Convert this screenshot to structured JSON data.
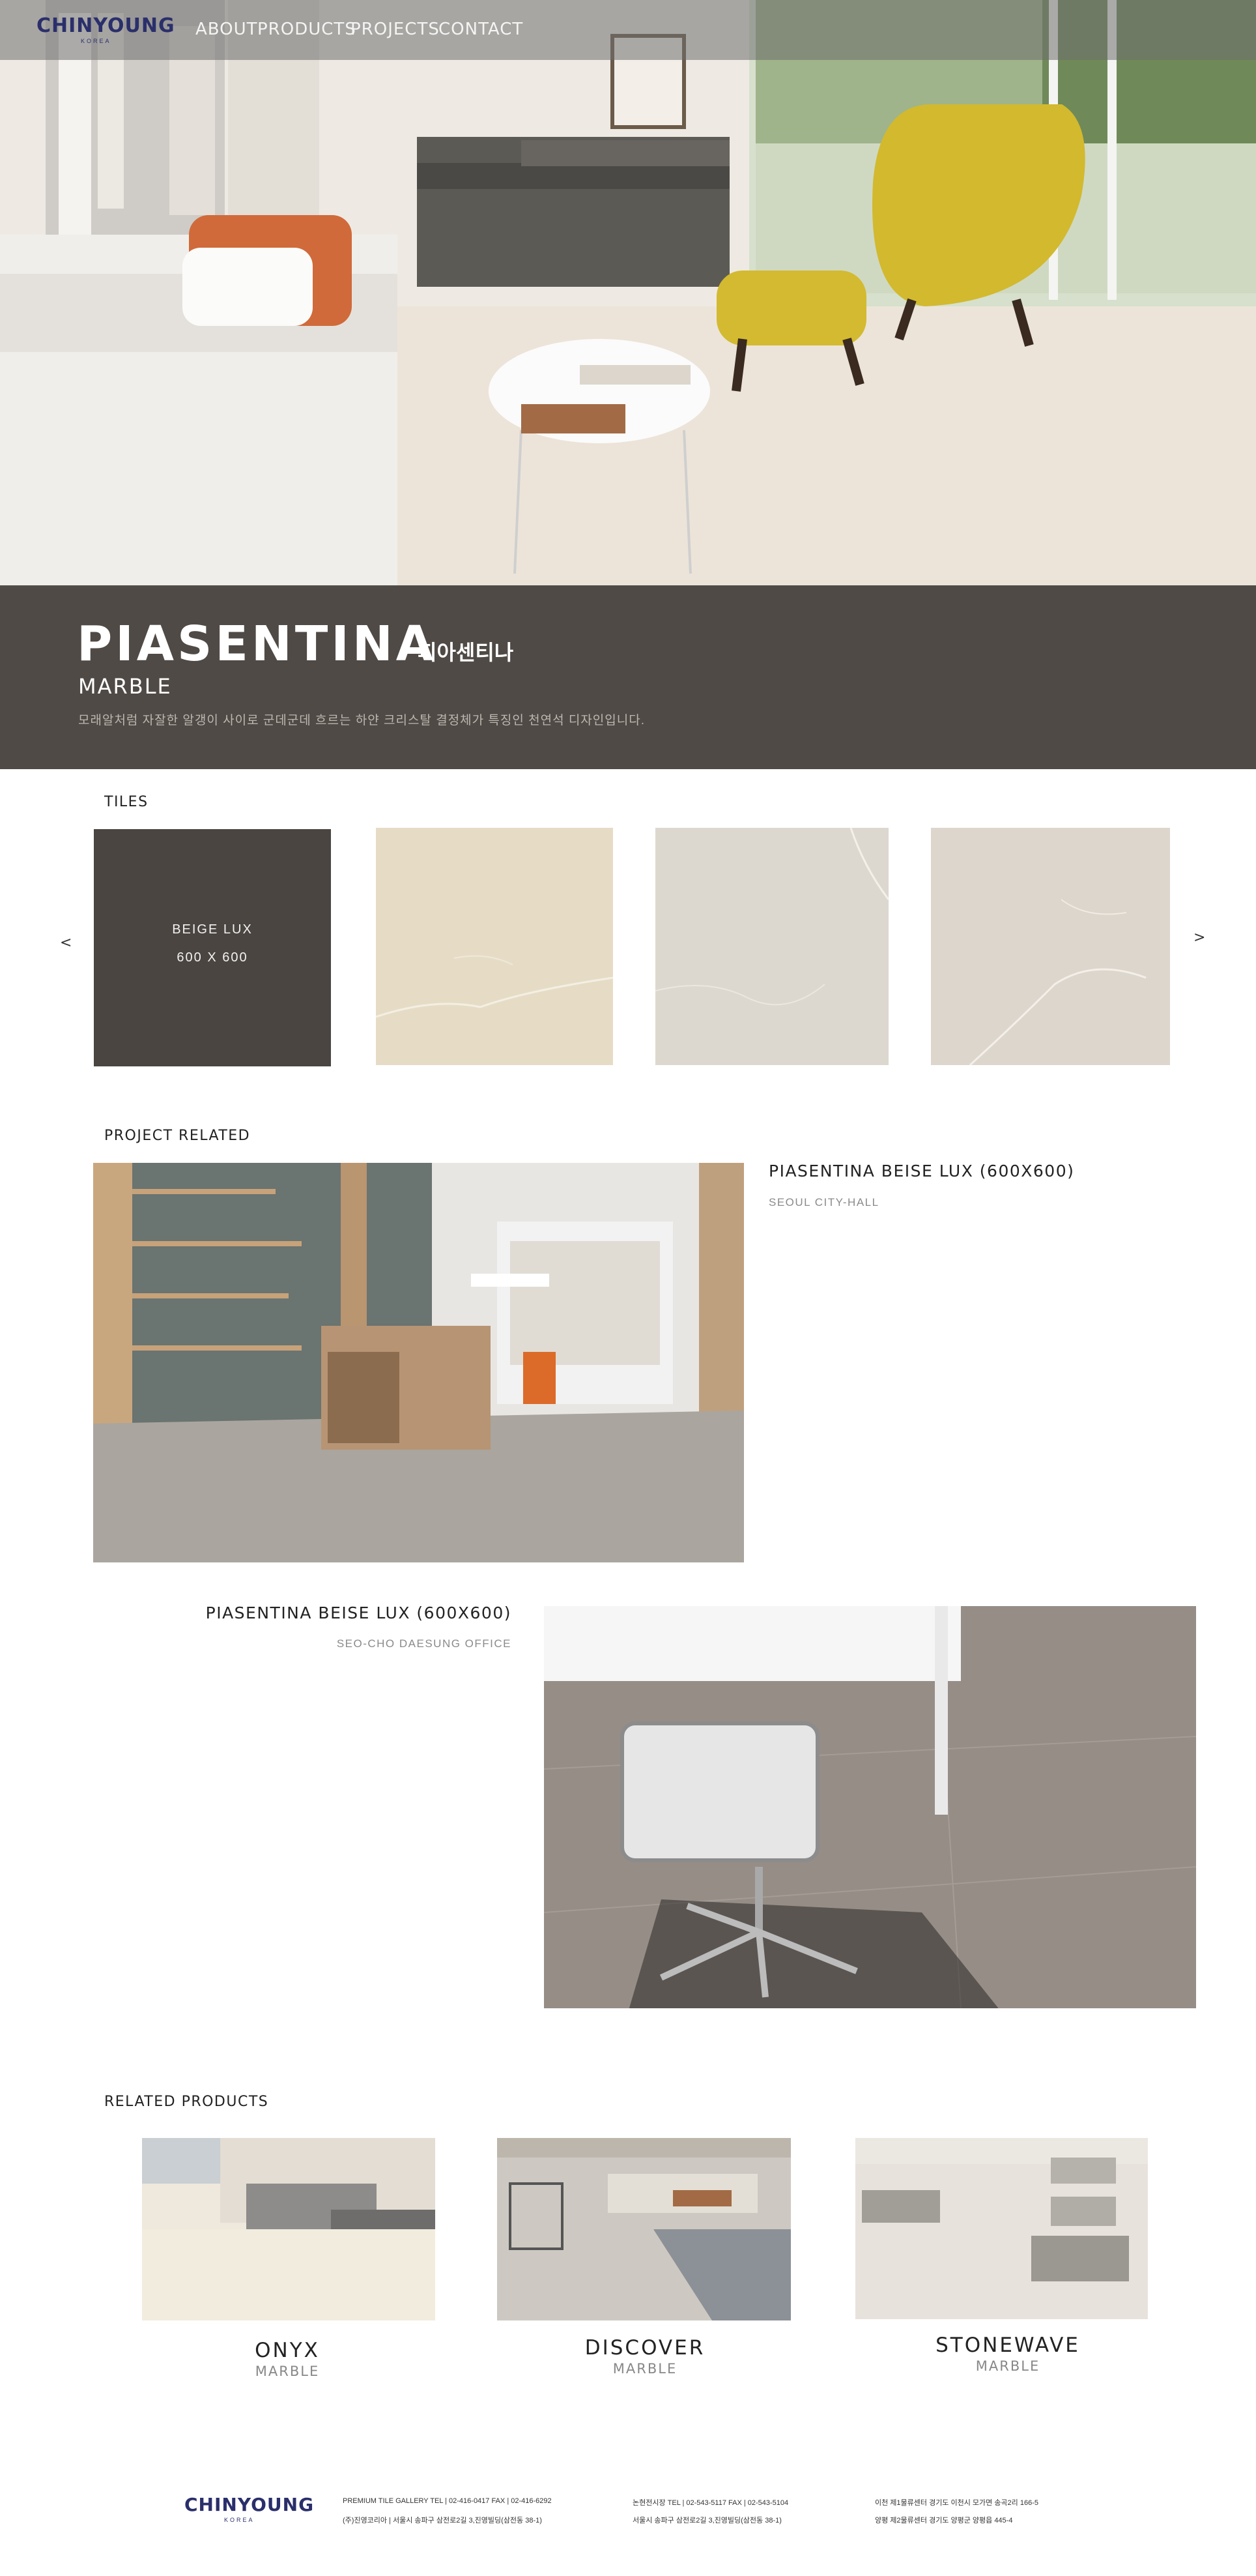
{
  "brand": {
    "logo": "CHINYOUNG",
    "logo_sub": "KOREA"
  },
  "nav": {
    "items": [
      "ABOUT",
      "PRODUCTS",
      "PROJECTS",
      "CONTACT"
    ]
  },
  "hero": {
    "title": "PIASENTINA",
    "title_ko": "피아센티나",
    "category": "MARBLE",
    "description": "모래알처럼 자잘한 알갱이 사이로 군데군데 흐르는 하얀 크리스탈 결정체가 특징인 천연석 디자인입니다."
  },
  "tiles": {
    "heading": "TILES",
    "prev": "<",
    "next": ">",
    "items": [
      {
        "name": "BEIGE LUX",
        "size": "600 X 600",
        "color": "#4a4541"
      },
      {
        "color": "#e6dcc6"
      },
      {
        "color": "#ddd8cf"
      },
      {
        "color": "#ddd6cc"
      }
    ]
  },
  "projects": {
    "heading": "PROJECT RELATED",
    "items": [
      {
        "title": "PIASENTINA BEISE LUX (600X600)",
        "location": "SEOUL CITY-HALL"
      },
      {
        "title": "PIASENTINA BEISE LUX (600X600)",
        "location": "SEO-CHO DAESUNG OFFICE"
      }
    ]
  },
  "related": {
    "heading": "RELATED PRODUCTS",
    "items": [
      {
        "name": "ONYX",
        "category": "MARBLE"
      },
      {
        "name": "DISCOVER",
        "category": "MARBLE"
      },
      {
        "name": "STONEWAVE",
        "category": "MARBLE"
      }
    ]
  },
  "footer": {
    "logo": "CHINYOUNG",
    "logo_sub": "KOREA",
    "col1_line1": "PREMIUM TILE GALLERY    TEL | 02-416-0417    FAX | 02-416-6292",
    "col1_line2": "(주)진영코리아 | 서울시 송파구 삼전로2길 3,진영빌딩(삼전동 38-1)",
    "col2_line1": "논현전시장    TEL | 02-543-5117    FAX | 02-543-5104",
    "col2_line2": "서울시 송파구 삼전로2길 3,진영빌딩(삼전동 38-1)",
    "col3_line1": "이천 제1물류센터    경기도 이천시 모가면 송곡2리 166-5",
    "col3_line2": "양평 제2물류센터    경기도 양평군 양평읍 445-4"
  }
}
